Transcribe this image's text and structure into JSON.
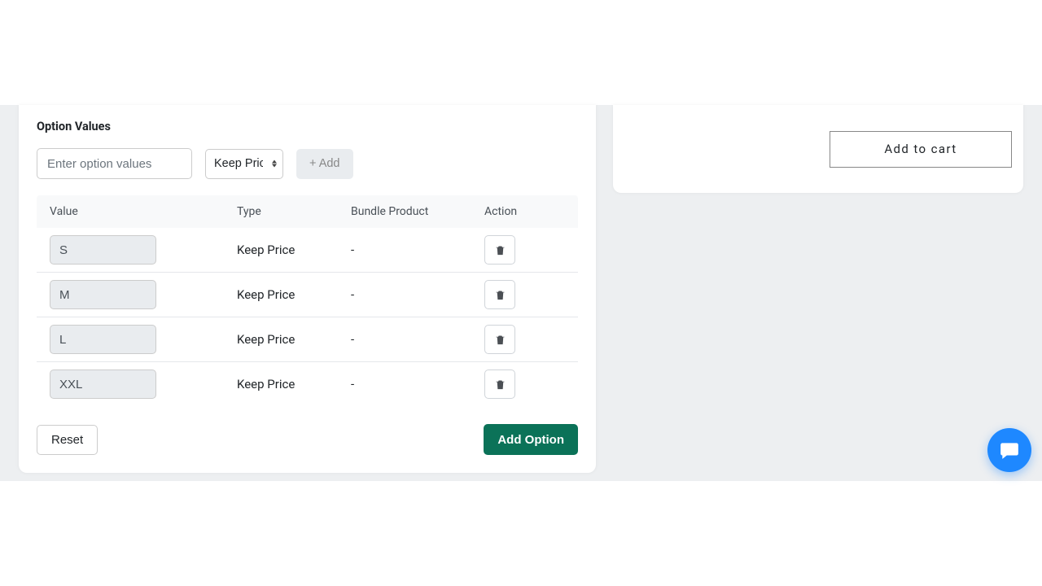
{
  "section": {
    "title": "Option Values"
  },
  "input": {
    "placeholder": "Enter option values"
  },
  "select": {
    "value": "Keep Price"
  },
  "buttons": {
    "add": "+ Add",
    "reset": "Reset",
    "add_option": "Add Option",
    "add_to_cart": "Add to cart"
  },
  "table": {
    "headers": {
      "value": "Value",
      "type": "Type",
      "bundle": "Bundle Product",
      "action": "Action"
    },
    "rows": [
      {
        "value": "S",
        "type": "Keep Price",
        "bundle": "-"
      },
      {
        "value": "M",
        "type": "Keep Price",
        "bundle": "-"
      },
      {
        "value": "L",
        "type": "Keep Price",
        "bundle": "-"
      },
      {
        "value": "XXL",
        "type": "Keep Price",
        "bundle": "-"
      }
    ]
  }
}
